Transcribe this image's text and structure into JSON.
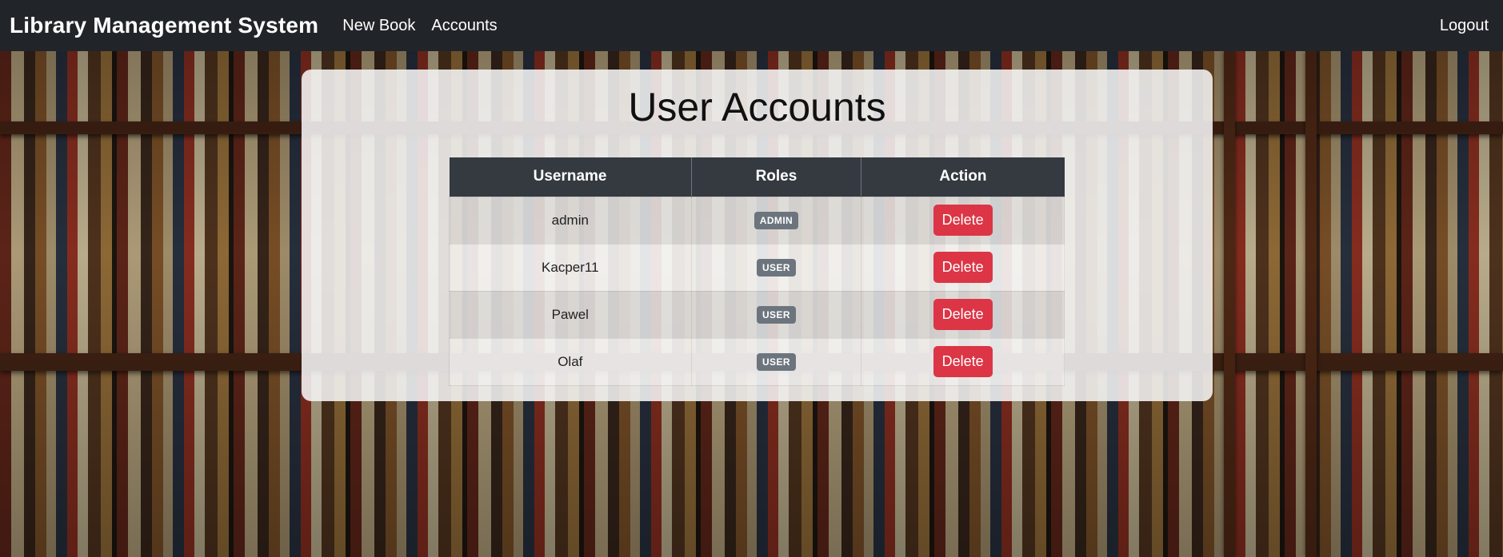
{
  "navbar": {
    "brand": "Library Management System",
    "links": [
      "New Book",
      "Accounts"
    ],
    "logout": "Logout"
  },
  "page": {
    "title": "User Accounts"
  },
  "table": {
    "headers": [
      "Username",
      "Roles",
      "Action"
    ],
    "rows": [
      {
        "username": "admin",
        "role": "ADMIN",
        "action": "Delete"
      },
      {
        "username": "Kacper11",
        "role": "USER",
        "action": "Delete"
      },
      {
        "username": "Pawel",
        "role": "USER",
        "action": "Delete"
      },
      {
        "username": "Olaf",
        "role": "USER",
        "action": "Delete"
      }
    ]
  },
  "colors": {
    "navbar": "#212529",
    "table_header": "#343a40",
    "badge": "#6c757d",
    "danger": "#dc3545"
  }
}
